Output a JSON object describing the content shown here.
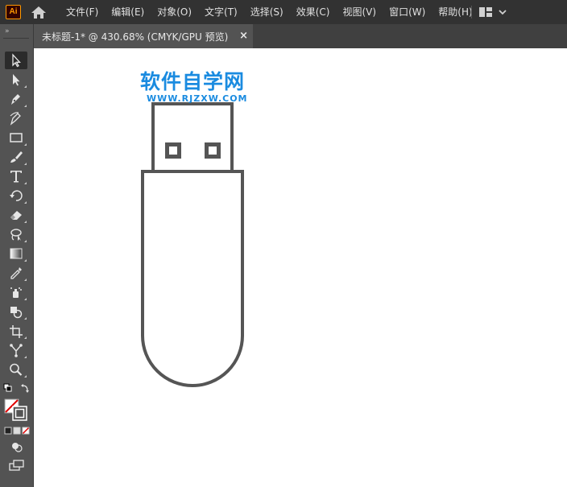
{
  "app": {
    "logo_text": "Ai",
    "menus": [
      {
        "label": "文件(F)"
      },
      {
        "label": "编辑(E)"
      },
      {
        "label": "对象(O)"
      },
      {
        "label": "文字(T)"
      },
      {
        "label": "选择(S)"
      },
      {
        "label": "效果(C)"
      },
      {
        "label": "视图(V)"
      },
      {
        "label": "窗口(W)"
      },
      {
        "label": "帮助(H)"
      }
    ],
    "workspace_icon": "workspace-layout-icon",
    "accent_color": "#ff9a00"
  },
  "document": {
    "tab_title": "未标题-1* @ 430.68% (CMYK/GPU 预览)",
    "close_glyph": "×"
  },
  "toolbar": {
    "tools": [
      {
        "name": "selection-tool-icon",
        "active": true
      },
      {
        "name": "direct-selection-tool-icon"
      },
      {
        "name": "pen-tool-icon"
      },
      {
        "name": "curvature-tool-icon"
      },
      {
        "name": "rectangle-tool-icon"
      },
      {
        "name": "paintbrush-tool-icon"
      },
      {
        "name": "type-tool-icon",
        "glyph": "T"
      },
      {
        "name": "rotate-tool-icon"
      },
      {
        "name": "eraser-tool-icon"
      },
      {
        "name": "lasso-tool-icon"
      },
      {
        "name": "gradient-tool-icon"
      },
      {
        "name": "eyedropper-tool-icon"
      },
      {
        "name": "symbol-sprayer-tool-icon"
      },
      {
        "name": "shape-builder-tool-icon"
      },
      {
        "name": "artboard-tool-icon"
      },
      {
        "name": "puppet-warp-tool-icon"
      },
      {
        "name": "zoom-tool-icon"
      }
    ]
  },
  "canvas": {
    "watermark_title": "软件自学网",
    "watermark_url": "WWW.RJZXW.COM",
    "watermark_color": "#1a8be0",
    "drawing_stroke_color": "#555555"
  }
}
